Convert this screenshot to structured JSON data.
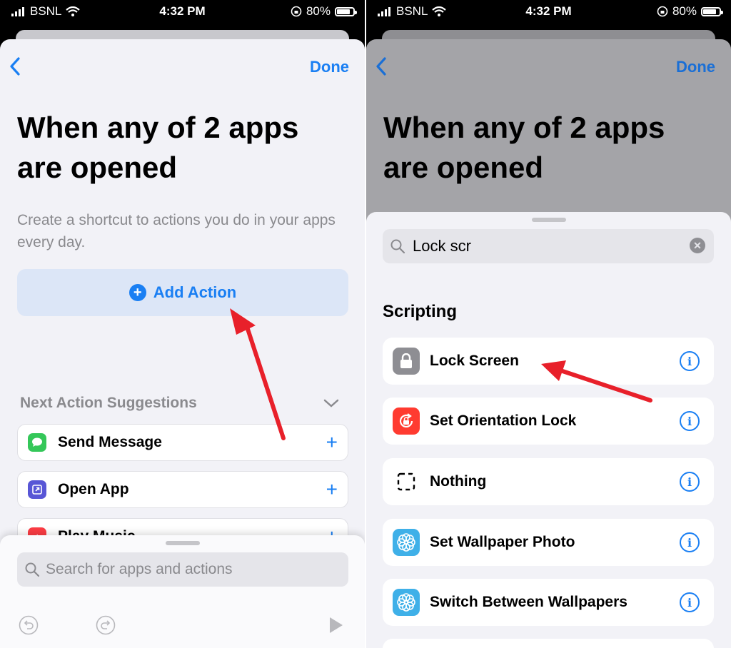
{
  "colors": {
    "accent": "#1a7ff3",
    "arrow": "#e8202a"
  },
  "status_bar": {
    "carrier": "BSNL",
    "time": "4:32 PM",
    "battery": "80%",
    "battery_level": 0.8
  },
  "left_screen": {
    "nav": {
      "back_icon": "chevron-left-icon",
      "done_label": "Done"
    },
    "title": "When any of 2 apps are opened",
    "subtitle": "Create a shortcut to actions you do in your apps every day.",
    "add_action_label": "Add Action",
    "suggestions": {
      "header": "Next Action Suggestions",
      "items": [
        {
          "label": "Send Message",
          "icon": "messages-icon",
          "color": "#34c759"
        },
        {
          "label": "Open App",
          "icon": "open-app-icon",
          "color": "#5856d6"
        },
        {
          "label": "Play Music",
          "icon": "music-icon",
          "color": "#fc3c44"
        }
      ]
    },
    "search": {
      "placeholder": "Search for apps and actions"
    }
  },
  "right_screen": {
    "nav": {
      "back_icon": "chevron-left-icon",
      "done_label": "Done"
    },
    "title": "When any of 2 apps are opened",
    "search": {
      "value": "Lock scr"
    },
    "section_title": "Scripting",
    "actions": [
      {
        "label": "Lock Screen",
        "icon": "lock-icon",
        "color": "#8e8e93"
      },
      {
        "label": "Set Orientation Lock",
        "icon": "orientation-lock-icon",
        "color": "#ff3b30"
      },
      {
        "label": "Nothing",
        "icon": "nothing-icon",
        "color": "#ffffff"
      },
      {
        "label": "Set Wallpaper Photo",
        "icon": "wallpaper-icon",
        "color": "#3fb0e8"
      },
      {
        "label": "Switch Between Wallpapers",
        "icon": "wallpaper-icon",
        "color": "#3fb0e8"
      }
    ]
  }
}
